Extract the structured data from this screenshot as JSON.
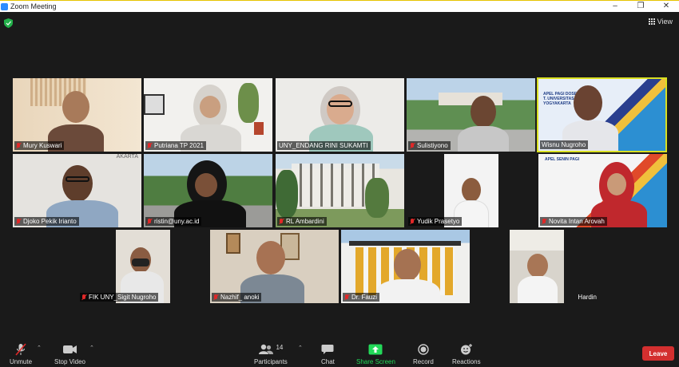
{
  "window": {
    "title": "Zoom Meeting",
    "controls": [
      "–",
      "❐",
      "✕"
    ]
  },
  "header": {
    "view_label": "View"
  },
  "participants": [
    {
      "name": "Mury Kuswari",
      "muted": true,
      "scene": "warm-wall"
    },
    {
      "name": "Putriana TP 2021",
      "muted": true,
      "scene": "white-room"
    },
    {
      "name": "UNY_ENDANG RINI SUKAMTI",
      "muted": false,
      "scene": "plain"
    },
    {
      "name": "Sulistiyono",
      "muted": true,
      "scene": "campus"
    },
    {
      "name": "Wisnu Nugroho",
      "muted": false,
      "scene": "banner",
      "active": true
    },
    {
      "name": "Djoko Pekik  Irianto",
      "muted": true,
      "scene": "wall-banner"
    },
    {
      "name": "ristin@uny.ac.id",
      "muted": true,
      "scene": "road"
    },
    {
      "name": "RL Ambardini",
      "muted": true,
      "scene": "building"
    },
    {
      "name": "Yudik Prasetyo",
      "muted": true,
      "scene": "white"
    },
    {
      "name": "Novita Intan Arovah",
      "muted": true,
      "scene": "banner2"
    },
    {
      "name": "FIK UNY_Sigit Nugroho",
      "muted": true,
      "scene": "office"
    },
    {
      "name": "Nazhif_ anoki",
      "muted": true,
      "scene": "room"
    },
    {
      "name": "Dr. Fauzi",
      "muted": true,
      "scene": "facade"
    },
    {
      "name": "Hardin",
      "muted": false,
      "scene": "car"
    }
  ],
  "banner_text": {
    "wisnu": "APEL PAGI DOSEN DAN T. UNIVERSITAS N YOGYAKARTA",
    "novita": "APEL SENIN PAGI",
    "djoko": "AKARTA"
  },
  "toolbar": {
    "unmute": "Unmute",
    "stop_video": "Stop Video",
    "participants": "Participants",
    "participants_count": "14",
    "chat": "Chat",
    "share_screen": "Share Screen",
    "record": "Record",
    "reactions": "Reactions",
    "leave": "Leave"
  },
  "colors": {
    "accent_green": "#23d959",
    "leave_red": "#d32f2f",
    "active_border": "#d9e021",
    "mute_red": "#e02828"
  }
}
